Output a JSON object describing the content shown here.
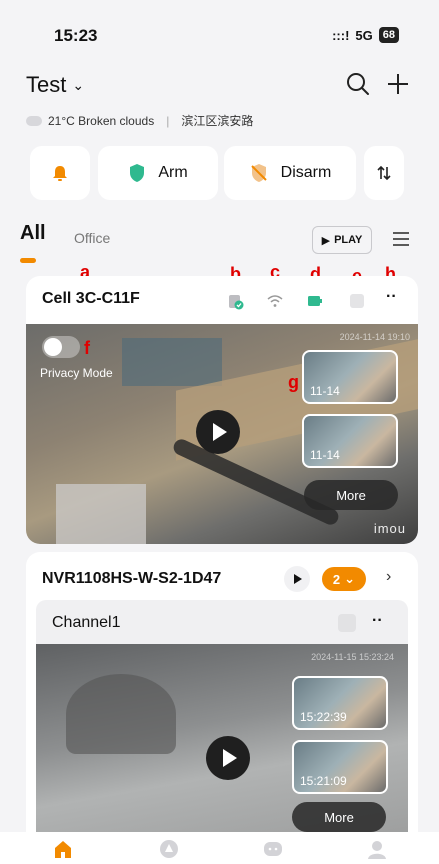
{
  "status_bar": {
    "time": "15:23",
    "signal": ":::!",
    "network": "5G",
    "battery": "68"
  },
  "header": {
    "home_name": "Test",
    "chevron": "⌄",
    "icons": [
      "search-icon",
      "add-icon"
    ]
  },
  "weather": {
    "temp_desc": "21°C Broken clouds",
    "separator": "|",
    "location": "滨江区滨安路"
  },
  "quick_actions": {
    "arm_label": "Arm",
    "disarm_label": "Disarm",
    "icons": [
      "bell-icon",
      "shield-icon",
      "shield-off-icon",
      "sort-icon"
    ]
  },
  "tabs": {
    "all": "All",
    "office": "Office",
    "play_all": "PLAY"
  },
  "annotations": {
    "a": "a",
    "b": "b",
    "c": "c",
    "d": "d",
    "e": "e",
    "f": "f",
    "g": "g",
    "h": "h"
  },
  "device1": {
    "name": "Cell 3C-C11F",
    "dots": "··",
    "timestamp": "2024-11-14 19:10",
    "privacy_label": "Privacy Mode",
    "clips": [
      "11-14",
      "11-14"
    ],
    "more_label": "More",
    "brand": "imou"
  },
  "device2": {
    "name": "NVR1108HS-W-S2-1D47",
    "channel_count": "2",
    "chevron_down": "⌄",
    "chevron_right": "›",
    "channel": {
      "name": "Channel1",
      "dots": "··",
      "timestamp": "2024-11-15 15:23:24",
      "clips": [
        "15:22:39",
        "15:21:09"
      ],
      "more_label": "More"
    }
  },
  "colors": {
    "accent": "#f28a00",
    "arm_green": "#2fb98f",
    "annotation_red": "#e00000"
  },
  "bottom_nav": [
    "home-icon",
    "scene-icon",
    "message-icon",
    "profile-icon"
  ]
}
